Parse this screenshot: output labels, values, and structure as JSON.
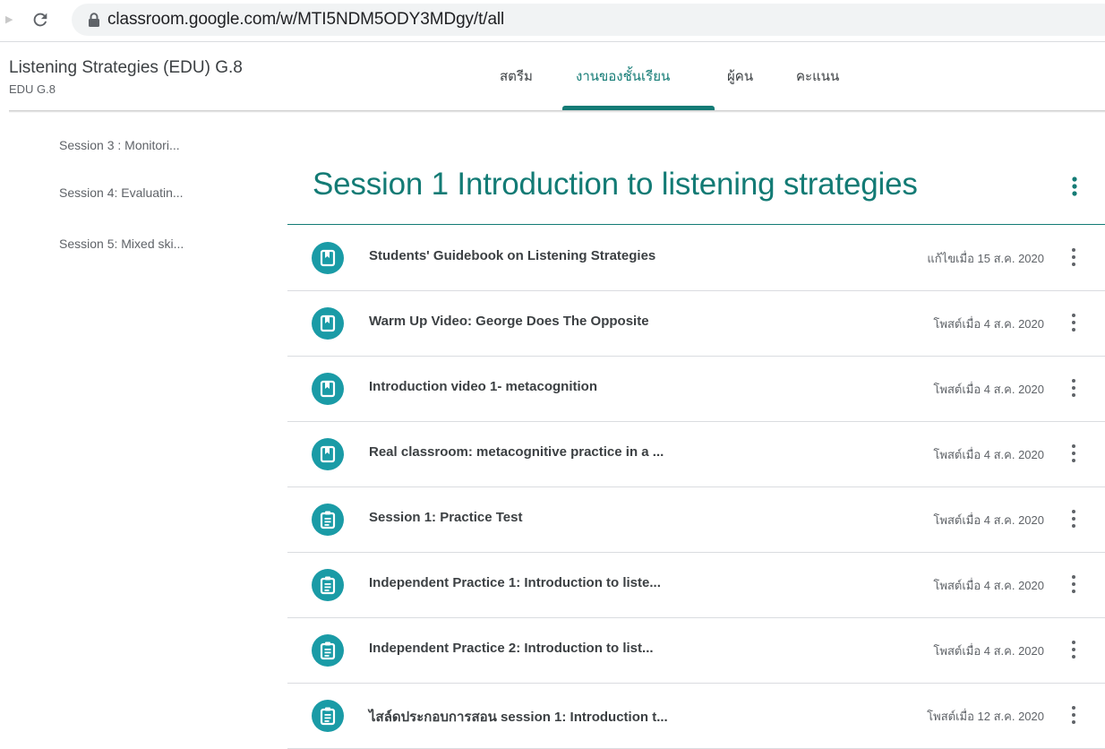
{
  "browser": {
    "url": "classroom.google.com/w/MTI5NDM5ODY3MDgy/t/all"
  },
  "header": {
    "class_title": "Listening Strategies (EDU) G.8",
    "class_subtitle": "EDU G.8",
    "tabs": [
      {
        "label": "สตรีม"
      },
      {
        "label": "งานของชั้นเรียน"
      },
      {
        "label": "ผู้คน"
      },
      {
        "label": "คะแนน"
      }
    ],
    "active_tab": "งานของชั้นเรียน",
    "accent_color": "#137b75"
  },
  "sidebar": {
    "items": [
      {
        "label": "Session 3 : Monitori..."
      },
      {
        "label": "Session 4: Evaluatin..."
      },
      {
        "label": "Session 5: Mixed ski..."
      }
    ]
  },
  "topic": {
    "title": "Session 1 Introduction to listening strategies",
    "items": [
      {
        "title": "Students' Guidebook on Listening Strategies",
        "date": "แก้ไขเมื่อ 15 ส.ค. 2020",
        "icon": "material-icon"
      },
      {
        "title": "Warm Up Video: George Does The Opposite",
        "date": "โพสต์เมื่อ 4 ส.ค. 2020",
        "icon": "material-icon"
      },
      {
        "title": "Introduction video 1- metacognition",
        "date": "โพสต์เมื่อ 4 ส.ค. 2020",
        "icon": "material-icon"
      },
      {
        "title": "Real classroom: metacognitive practice in a ...",
        "date": "โพสต์เมื่อ 4 ส.ค. 2020",
        "icon": "material-icon"
      },
      {
        "title": "Session 1: Practice Test",
        "date": "โพสต์เมื่อ 4 ส.ค. 2020",
        "icon": "assignment-icon"
      },
      {
        "title": "Independent Practice 1: Introduction to liste...",
        "date": "โพสต์เมื่อ 4 ส.ค. 2020",
        "icon": "assignment-icon"
      },
      {
        "title": "Independent Practice 2: Introduction to list...",
        "date": "โพสต์เมื่อ 4 ส.ค. 2020",
        "icon": "assignment-icon"
      },
      {
        "title": "ไสล์ดประกอบการสอน session 1: Introduction t...",
        "date": "โพสต์เมื่อ 12 ส.ค. 2020",
        "icon": "assignment-icon"
      }
    ]
  }
}
